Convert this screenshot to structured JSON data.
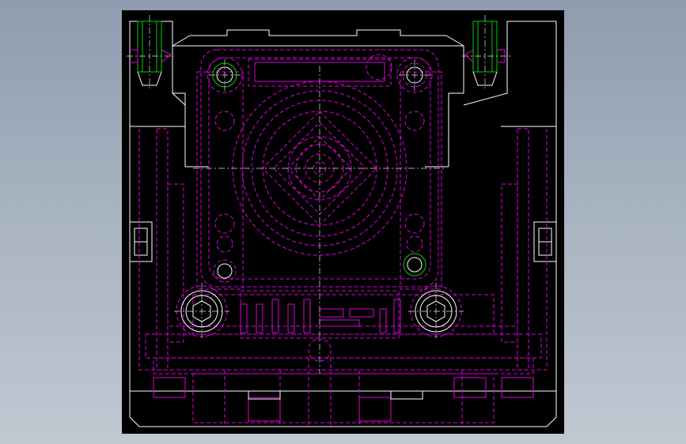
{
  "app": {
    "viewport_background": "#000000",
    "window_background": "#a0aab8"
  },
  "colors": {
    "outline": "#ffffff",
    "hidden_lines": "#e000e0",
    "bolt_threads": "#00d000",
    "center_lines": "#e0e0e0"
  },
  "drawing": {
    "type": "CAD mold assembly top view",
    "layers": [
      "outline",
      "hidden-lines",
      "bolt-threads",
      "center-lines"
    ]
  }
}
